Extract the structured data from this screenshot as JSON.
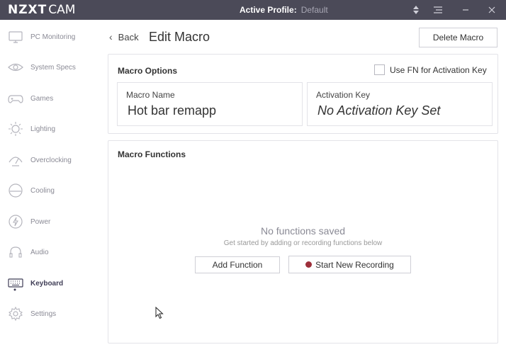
{
  "titlebar": {
    "logo_bold": "NZXT",
    "logo_light": "CAM",
    "profile_label": "Active Profile:",
    "profile_value": "Default",
    "icons": [
      "sort-icon",
      "menu-icon",
      "minimize-icon",
      "close-icon"
    ]
  },
  "sidebar": {
    "items": [
      {
        "label": "PC Monitoring",
        "icon": "monitor-icon"
      },
      {
        "label": "System Specs",
        "icon": "eye-icon"
      },
      {
        "label": "Games",
        "icon": "gamepad-icon"
      },
      {
        "label": "Lighting",
        "icon": "sun-icon"
      },
      {
        "label": "Overclocking",
        "icon": "gauge-icon"
      },
      {
        "label": "Cooling",
        "icon": "cooling-icon"
      },
      {
        "label": "Power",
        "icon": "power-icon"
      },
      {
        "label": "Audio",
        "icon": "headset-icon"
      },
      {
        "label": "Keyboard",
        "icon": "keyboard-icon",
        "active": true
      },
      {
        "label": "Settings",
        "icon": "gear-icon"
      }
    ]
  },
  "header": {
    "back_label": "Back",
    "title": "Edit Macro",
    "delete_label": "Delete Macro"
  },
  "options": {
    "title": "Macro Options",
    "fn_label": "Use FN for Activation Key",
    "fn_checked": false,
    "name_label": "Macro Name",
    "name_value": "Hot bar remapp",
    "key_label": "Activation Key",
    "key_value": "No Activation Key Set"
  },
  "functions": {
    "title": "Macro Functions",
    "empty_title": "No functions saved",
    "empty_sub": "Get started by adding or recording functions below",
    "add_label": "Add Function",
    "record_label": "Start New Recording"
  },
  "colors": {
    "titlebar": "#4b4a58",
    "record_dot": "#9d2f3a",
    "active_nav": "#3f3d56"
  }
}
